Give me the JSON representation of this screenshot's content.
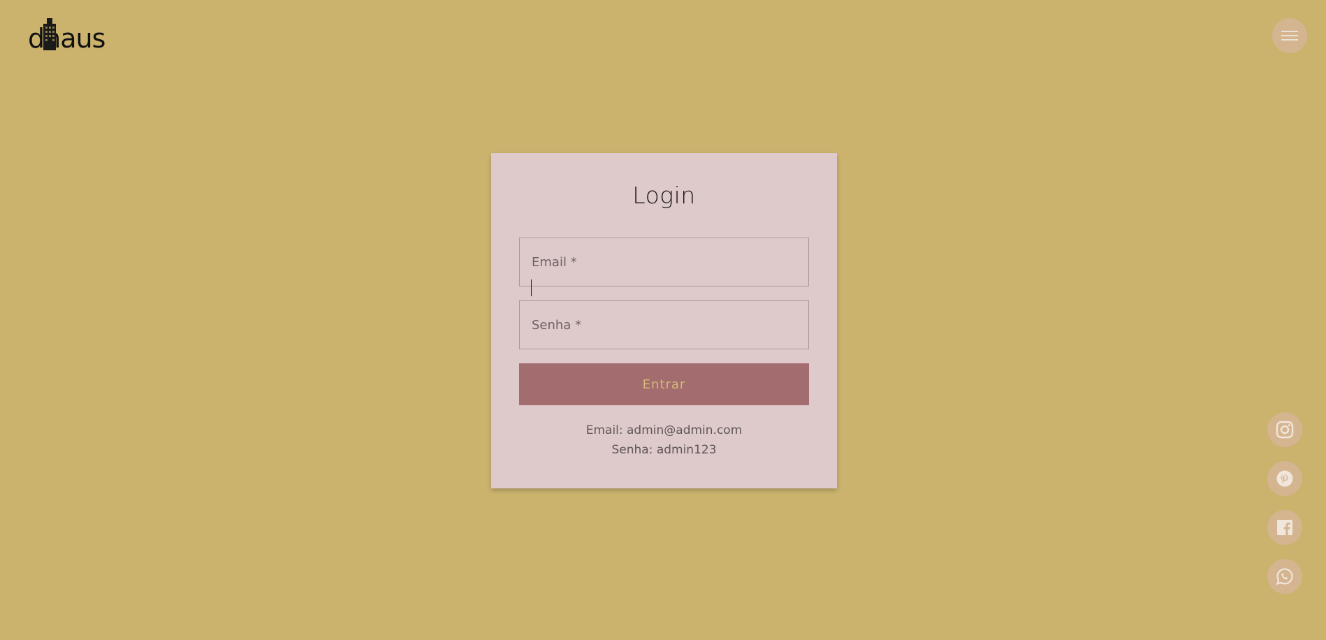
{
  "header": {
    "logo_text": "dnaus",
    "menu_icon": "hamburger-icon"
  },
  "login": {
    "title": "Login",
    "email_placeholder": "Email *",
    "password_placeholder": "Senha *",
    "submit_label": "Entrar",
    "hint_email": "Email: admin@admin.com",
    "hint_password": "Senha: admin123"
  },
  "social": [
    {
      "name": "instagram-icon"
    },
    {
      "name": "pinterest-icon"
    },
    {
      "name": "facebook-icon"
    },
    {
      "name": "whatsapp-icon"
    }
  ],
  "colors": {
    "background": "#cbb36e",
    "card": "#dfcacb",
    "button": "#a36d6f",
    "button_text": "#d6b878",
    "circle": "#d4b590"
  }
}
